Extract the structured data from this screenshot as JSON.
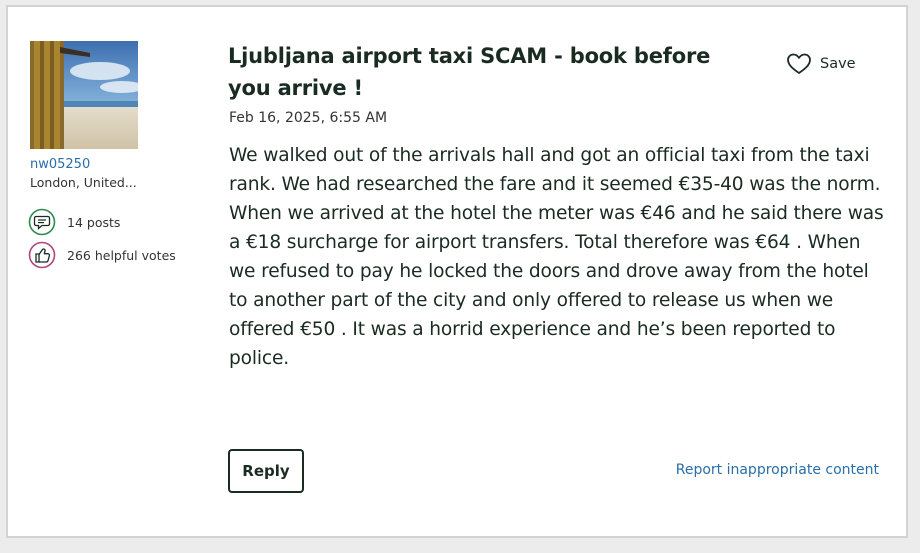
{
  "author": {
    "username": "nw05250",
    "location": "London, United...",
    "posts": "14 posts",
    "helpful_votes": "266 helpful votes",
    "avatar_icon": "beach-hut-photo"
  },
  "post": {
    "title": "Ljubljana airport taxi SCAM - book before you arrive !",
    "date": "Feb 16, 2025, 6:55 AM",
    "body": "We walked out of the arrivals hall and got an official taxi from the taxi rank. We had researched the fare and it seemed €35-40 was the norm. When we arrived at the hotel the meter was €46 and he said there was a €18 surcharge for airport transfers. Total therefore was €64 . When we refused to pay he locked the doors and drove away from the hotel to another part of the city and only offered to release us when we offered €50 . It was a horrid experience and he’s been reported to police."
  },
  "actions": {
    "save_label": "Save",
    "reply_label": "Reply",
    "report_label": "Report inappropriate content"
  },
  "icons": {
    "save": "heart-icon",
    "posts": "speech-bubble-icon",
    "votes": "thumbs-up-icon"
  },
  "colors": {
    "text": "#1a2b22",
    "link": "#2a6ea8",
    "posts_icon": "#2f8a4f",
    "votes_icon": "#b0457d"
  }
}
